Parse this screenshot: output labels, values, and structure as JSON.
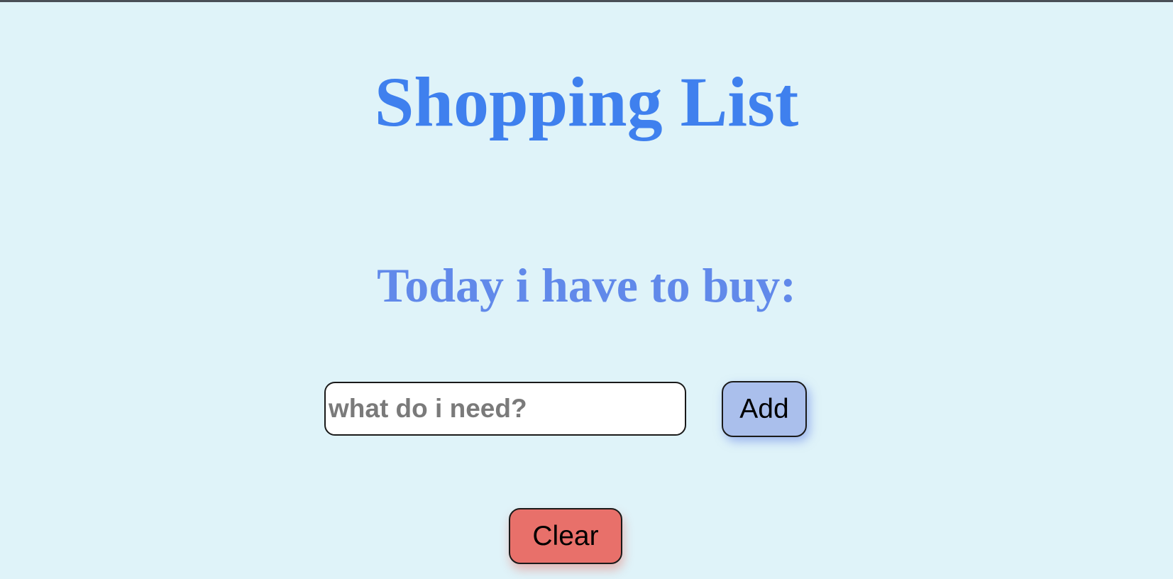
{
  "header": {
    "title": "Shopping List",
    "subtitle": "Today i have to buy:"
  },
  "form": {
    "input_value": "",
    "input_placeholder": "what do i need?",
    "add_label": "Add",
    "clear_label": "Clear"
  },
  "colors": {
    "background": "#dff3f9",
    "title": "#3f80ee",
    "subtitle": "#6189ea",
    "add_button": "#aabfec",
    "clear_button": "#e8706a"
  }
}
